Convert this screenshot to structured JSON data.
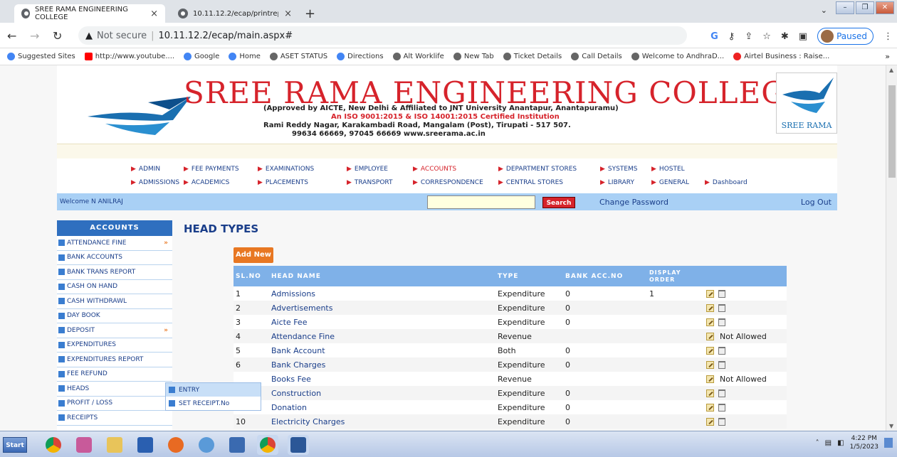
{
  "browser": {
    "tabs": [
      {
        "title": "SREE RAMA ENGINEERING COLLEGE",
        "active": true
      },
      {
        "title": "10.11.12.2/ecap/printreport.aspx",
        "active": false
      }
    ],
    "address": {
      "not_secure": "Not secure",
      "url": "10.11.12.2/ecap/main.aspx#"
    },
    "profile_status": "Paused",
    "bookmarks": [
      "Suggested Sites",
      "http://www.youtube....",
      "Google",
      "Home",
      "ASET STATUS",
      "Directions",
      "Alt Worklife",
      "New Tab",
      "Ticket Details",
      "Call Details",
      "Welcome to AndhraD...",
      "Airtel Business : Raise..."
    ]
  },
  "header": {
    "college_name": "SREE RAMA ENGINEERING COLLEGE",
    "approval": "(Approved by AICTE, New Delhi & Affiliated to JNT University Anantapur, Anantapuramu)",
    "iso": "An ISO 9001:2015 & ISO 14001:2015 Certified Institution",
    "address": "Rami Reddy Nagar, Karakambadi Road, Mangalam (Post), Tirupati - 517 507.",
    "contact": "99634 66669, 97045 66669   www.sreerama.ac.in",
    "logo_text": "SREE RAMA"
  },
  "top_menu": {
    "row1": [
      "ADMIN",
      "FEE PAYMENTS",
      "EXAMINATIONS",
      "EMPLOYEE",
      "ACCOUNTS",
      "DEPARTMENT STORES",
      "SYSTEMS",
      "HOSTEL"
    ],
    "row2": [
      "ADMISSIONS",
      "ACADEMICS",
      "PLACEMENTS",
      "TRANSPORT",
      "CORRESPONDENCE",
      "CENTRAL STORES",
      "LIBRARY",
      "GENERAL",
      "Dashboard"
    ]
  },
  "userbar": {
    "welcome": "Welcome N ANILRAJ",
    "search_label": "Search",
    "change_password": "Change Password",
    "logout": "Log Out"
  },
  "sidebar": {
    "title": "ACCOUNTS",
    "items": [
      {
        "label": "ATTENDANCE FINE",
        "more": "»"
      },
      {
        "label": "BANK ACCOUNTS",
        "more": ""
      },
      {
        "label": "BANK TRANS REPORT",
        "more": ""
      },
      {
        "label": "CASH ON HAND",
        "more": ""
      },
      {
        "label": "CASH WITHDRAWL",
        "more": ""
      },
      {
        "label": "DAY BOOK",
        "more": ""
      },
      {
        "label": "DEPOSIT",
        "more": "»"
      },
      {
        "label": "EXPENDITURES",
        "more": ""
      },
      {
        "label": "EXPENDITURES REPORT",
        "more": ""
      },
      {
        "label": "FEE REFUND",
        "more": ""
      },
      {
        "label": "HEADS",
        "more": ""
      },
      {
        "label": "PROFIT / LOSS",
        "more": ""
      },
      {
        "label": "RECEIPTS",
        "more": ""
      }
    ],
    "submenu": [
      "ENTRY",
      "SET RECEIPT.No"
    ]
  },
  "main": {
    "title": "HEAD TYPES",
    "add_new": "Add New",
    "columns": [
      "SL.NO",
      "HEAD NAME",
      "TYPE",
      "BANK ACC.NO",
      "DISPLAY ORDER",
      ""
    ],
    "rows": [
      {
        "sl": "1",
        "name": "Admissions",
        "type": "Expenditure",
        "bank": "0",
        "order": "1",
        "action": "delete"
      },
      {
        "sl": "2",
        "name": "Advertisements",
        "type": "Expenditure",
        "bank": "0",
        "order": "",
        "action": "delete"
      },
      {
        "sl": "3",
        "name": "Aicte Fee",
        "type": "Expenditure",
        "bank": "0",
        "order": "",
        "action": "delete"
      },
      {
        "sl": "4",
        "name": "Attendance Fine",
        "type": "Revenue",
        "bank": "",
        "order": "",
        "action": "Not Allowed"
      },
      {
        "sl": "5",
        "name": "Bank Account",
        "type": "Both",
        "bank": "0",
        "order": "",
        "action": "delete"
      },
      {
        "sl": "6",
        "name": "Bank Charges",
        "type": "Expenditure",
        "bank": "0",
        "order": "",
        "action": "delete"
      },
      {
        "sl": "",
        "name": "Books Fee",
        "type": "Revenue",
        "bank": "",
        "order": "",
        "action": "Not Allowed"
      },
      {
        "sl": "",
        "name": "Construction",
        "type": "Expenditure",
        "bank": "0",
        "order": "",
        "action": "delete"
      },
      {
        "sl": "9",
        "name": "Donation",
        "type": "Expenditure",
        "bank": "0",
        "order": "",
        "action": "delete"
      },
      {
        "sl": "10",
        "name": "Electricity Charges",
        "type": "Expenditure",
        "bank": "0",
        "order": "",
        "action": "delete"
      }
    ]
  },
  "taskbar": {
    "start": "Start",
    "time": "4:22 PM",
    "date": "1/5/2023"
  }
}
